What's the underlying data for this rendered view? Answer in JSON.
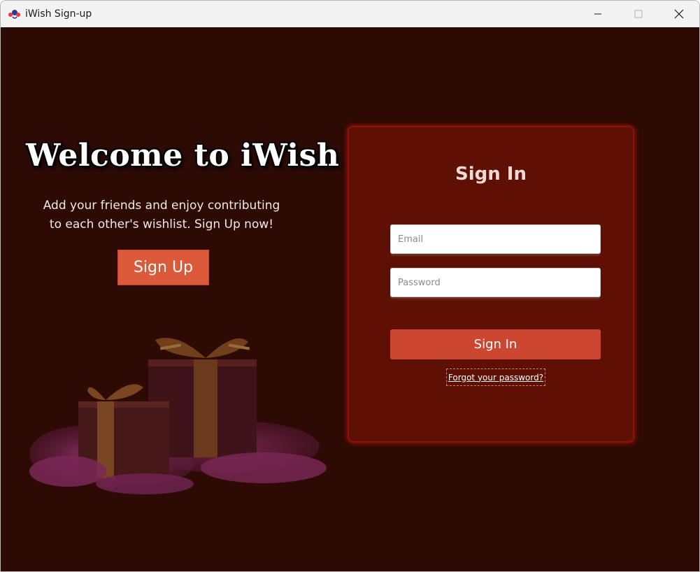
{
  "window": {
    "title": "iWish Sign-up",
    "app_icon": "iwish-logo-icon",
    "controls": [
      "minimize-icon",
      "maximize-icon",
      "close-icon"
    ]
  },
  "welcome": {
    "title": "Welcome to iWish",
    "subtitle_line1": "Add your friends and enjoy contributing",
    "subtitle_line2": "to each other's wishlist. Sign Up now!",
    "signup_label": "Sign Up",
    "illustration": "gift-boxes-illustration"
  },
  "signin": {
    "title": "Sign In",
    "email_placeholder": "Email",
    "email_value": "",
    "password_placeholder": "Password",
    "password_value": "",
    "button_label": "Sign In",
    "forgot_label": "Forgot your password?"
  },
  "colors": {
    "background": "#2d0a04",
    "card": "#5e1004",
    "accent": "#cd4730",
    "signup_button": "#dc5a3a"
  }
}
